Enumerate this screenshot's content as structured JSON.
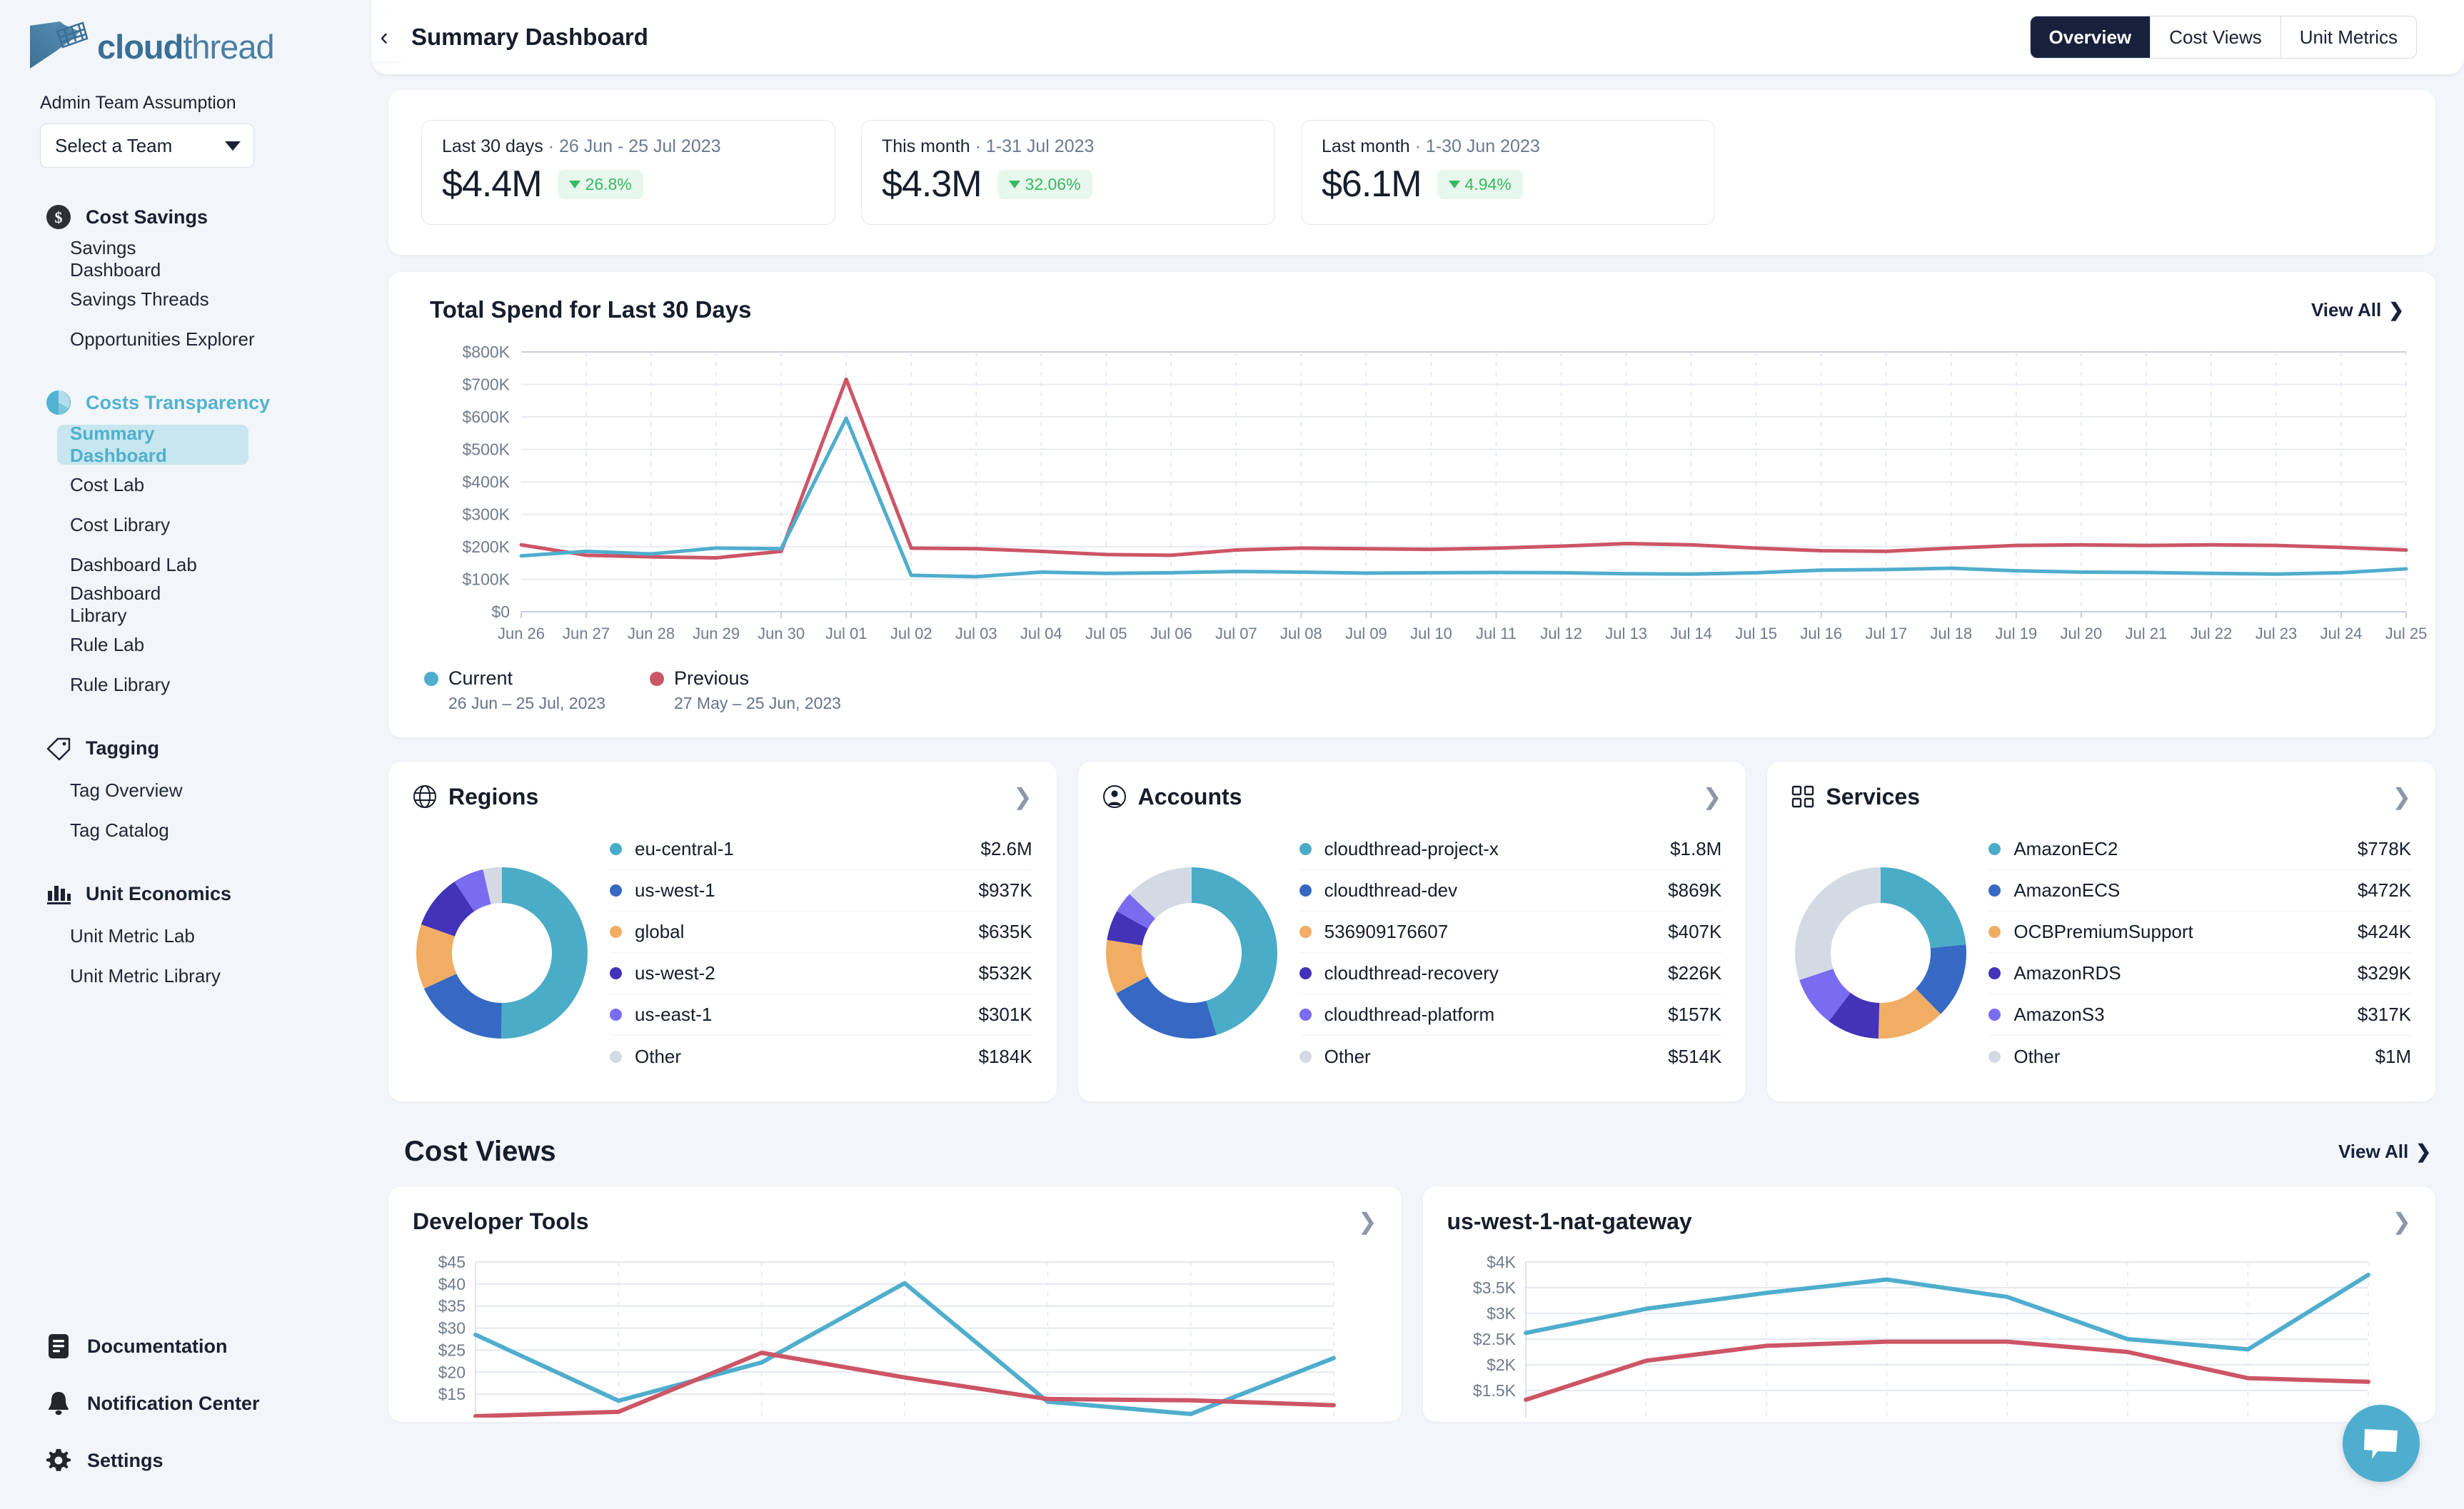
{
  "brand": {
    "name_bold": "cloud",
    "name_light": "thread"
  },
  "sidebar": {
    "team_label": "Admin Team Assumption",
    "team_select_value": "Select a Team",
    "groups": [
      {
        "icon": "dollar-circle-icon",
        "label": "Cost Savings",
        "active": false,
        "items": [
          "Savings Dashboard",
          "Savings Threads",
          "Opportunities Explorer"
        ]
      },
      {
        "icon": "pie-chart-icon",
        "label": "Costs Transparency",
        "active": true,
        "items": [
          "Summary Dashboard",
          "Cost Lab",
          "Cost Library",
          "Dashboard Lab",
          "Dashboard Library",
          "Rule Lab",
          "Rule Library"
        ]
      },
      {
        "icon": "tag-icon",
        "label": "Tagging",
        "active": false,
        "items": [
          "Tag Overview",
          "Tag Catalog"
        ]
      },
      {
        "icon": "bar-chart-icon",
        "label": "Unit Economics",
        "active": false,
        "items": [
          "Unit Metric Lab",
          "Unit Metric Library"
        ]
      }
    ],
    "selected_item": "Summary Dashboard",
    "bottom": [
      {
        "icon": "document-icon",
        "label": "Documentation"
      },
      {
        "icon": "bell-icon",
        "label": "Notification Center"
      },
      {
        "icon": "gear-icon",
        "label": "Settings"
      }
    ]
  },
  "header": {
    "title": "Summary Dashboard",
    "back_icon": "chevron-left-icon",
    "tabs": [
      {
        "label": "Overview",
        "active": true
      },
      {
        "label": "Cost Views",
        "active": false
      },
      {
        "label": "Unit Metrics",
        "active": false
      }
    ]
  },
  "kpis": [
    {
      "period": "Last 30 days",
      "range": "26 Jun - 25 Jul 2023",
      "value": "$4.4M",
      "delta": "26.8%",
      "direction": "down"
    },
    {
      "period": "This month",
      "range": "1-31 Jul 2023",
      "value": "$4.3M",
      "delta": "32.06%",
      "direction": "down"
    },
    {
      "period": "Last month",
      "range": "1-30 Jun 2023",
      "value": "$6.1M",
      "delta": "4.94%",
      "direction": "down"
    }
  ],
  "spend_chart": {
    "title": "Total Spend for Last 30 Days",
    "view_all": "View All",
    "legend": [
      {
        "name": "Current",
        "range": "26 Jun – 25 Jul, 2023",
        "color": "#4fadcd"
      },
      {
        "name": "Previous",
        "range": "27 May – 25 Jun, 2023",
        "color": "#cc5566"
      }
    ]
  },
  "chart_data": [
    {
      "type": "line",
      "id": "total-spend-last-30-days",
      "title": "Total Spend for Last 30 Days",
      "xlabel": "",
      "ylabel": "",
      "ylim": [
        0,
        800000
      ],
      "yticks": [
        0,
        100000,
        200000,
        300000,
        400000,
        500000,
        600000,
        700000,
        800000
      ],
      "ytick_labels": [
        "$0",
        "$100K",
        "$200K",
        "$300K",
        "$400K",
        "$500K",
        "$600K",
        "$700K",
        "$800K"
      ],
      "grid": true,
      "legend_position": "bottom-left",
      "categories": [
        "Jun 26",
        "Jun 27",
        "Jun 28",
        "Jun 29",
        "Jun 30",
        "Jul 01",
        "Jul 02",
        "Jul 03",
        "Jul 04",
        "Jul 05",
        "Jul 06",
        "Jul 07",
        "Jul 08",
        "Jul 09",
        "Jul 10",
        "Jul 11",
        "Jul 12",
        "Jul 13",
        "Jul 14",
        "Jul 15",
        "Jul 16",
        "Jul 17",
        "Jul 18",
        "Jul 19",
        "Jul 20",
        "Jul 21",
        "Jul 22",
        "Jul 23",
        "Jul 24",
        "Jul 25"
      ],
      "series": [
        {
          "name": "Current",
          "color": "#4fadcd",
          "values": [
            172000,
            186000,
            178000,
            196000,
            194000,
            596000,
            112000,
            108000,
            122000,
            118000,
            120000,
            124000,
            122000,
            119000,
            120000,
            121000,
            120000,
            117000,
            116000,
            120000,
            128000,
            130000,
            134000,
            126000,
            122000,
            121000,
            118000,
            116000,
            120000,
            132000
          ]
        },
        {
          "name": "Previous",
          "color": "#cc5566",
          "values": [
            206000,
            174000,
            169000,
            166000,
            186000,
            716000,
            196000,
            194000,
            186000,
            176000,
            174000,
            190000,
            196000,
            194000,
            192000,
            196000,
            202000,
            210000,
            206000,
            196000,
            188000,
            186000,
            196000,
            204000,
            206000,
            204000,
            206000,
            204000,
            198000,
            190000
          ]
        }
      ]
    },
    {
      "type": "pie",
      "id": "regions-donut",
      "title": "Regions",
      "labels": [
        "eu-central-1",
        "us-west-1",
        "global",
        "us-west-2",
        "us-east-1",
        "Other"
      ],
      "values": [
        2600000,
        937000,
        635000,
        532000,
        301000,
        184000
      ],
      "value_labels": [
        "$2.6M",
        "$937K",
        "$635K",
        "$532K",
        "$301K",
        "$184K"
      ],
      "colors": [
        "#4aacc6",
        "#3669c4",
        "#f0ad63",
        "#4233b8",
        "#7a6cf0",
        "#d3dae3"
      ]
    },
    {
      "type": "pie",
      "id": "accounts-donut",
      "title": "Accounts",
      "labels": [
        "cloudthread-project-x",
        "cloudthread-dev",
        "536909176607",
        "cloudthread-recovery",
        "cloudthread-platform",
        "Other"
      ],
      "values": [
        1800000,
        869000,
        407000,
        226000,
        157000,
        514000
      ],
      "value_labels": [
        "$1.8M",
        "$869K",
        "$407K",
        "$226K",
        "$157K",
        "$514K"
      ],
      "colors": [
        "#4aacc6",
        "#3669c4",
        "#f0ad63",
        "#4233b8",
        "#7a6cf0",
        "#d3dae3"
      ]
    },
    {
      "type": "pie",
      "id": "services-donut",
      "title": "Services",
      "labels": [
        "AmazonEC2",
        "AmazonECS",
        "OCBPremiumSupport",
        "AmazonRDS",
        "AmazonS3",
        "Other"
      ],
      "values": [
        778000,
        472000,
        424000,
        329000,
        317000,
        1000000
      ],
      "value_labels": [
        "$778K",
        "$472K",
        "$424K",
        "$329K",
        "$317K",
        "$1M"
      ],
      "colors": [
        "#4aacc6",
        "#3669c4",
        "#f0ad63",
        "#4233b8",
        "#7a6cf0",
        "#d3dae3"
      ]
    },
    {
      "type": "line",
      "id": "developer-tools",
      "title": "Developer Tools",
      "ylim": [
        10,
        45
      ],
      "yticks": [
        15,
        20,
        25,
        30,
        35,
        40,
        45
      ],
      "ytick_labels": [
        "$15",
        "$20",
        "$25",
        "$30",
        "$35",
        "$40",
        "$45"
      ],
      "grid": true,
      "series": [
        {
          "name": "Current",
          "color": "#4fadcd",
          "values": [
            28.5,
            13.5,
            22.2,
            40.2,
            13.3,
            10.5,
            23.2
          ]
        },
        {
          "name": "Previous",
          "color": "#cc5566",
          "values": [
            10.0,
            11.0,
            24.4,
            18.8,
            13.9,
            13.6,
            12.5
          ]
        }
      ]
    },
    {
      "type": "line",
      "id": "us-west-1-nat-gateway",
      "title": "us-west-1-nat-gateway",
      "ylim": [
        1000,
        4000
      ],
      "yticks": [
        1500,
        2000,
        2500,
        3000,
        3500,
        4000
      ],
      "ytick_labels": [
        "$1.5K",
        "$2K",
        "$2.5K",
        "$3K",
        "$3.5K",
        "$4K"
      ],
      "grid": true,
      "series": [
        {
          "name": "Current",
          "color": "#4fadcd",
          "values": [
            2620,
            3090,
            3400,
            3660,
            3320,
            2500,
            2300,
            3750
          ]
        },
        {
          "name": "Previous",
          "color": "#cc5566",
          "values": [
            1320,
            2080,
            2370,
            2450,
            2450,
            2250,
            1740,
            1670
          ]
        }
      ]
    }
  ],
  "cards": {
    "regions": {
      "title": "Regions",
      "icon": "globe-icon"
    },
    "accounts": {
      "title": "Accounts",
      "icon": "user-circle-icon"
    },
    "services": {
      "title": "Services",
      "icon": "grid-icon"
    }
  },
  "cost_views": {
    "title": "Cost Views",
    "view_all": "View All",
    "cards": [
      {
        "title": "Developer Tools"
      },
      {
        "title": "us-west-1-nat-gateway"
      }
    ]
  },
  "chat": {
    "icon": "chat-bubble-icon"
  },
  "colors": {
    "accent": "#4fadcd",
    "previous": "#cc5566",
    "dark": "#18213c",
    "positive": "#38b862"
  }
}
